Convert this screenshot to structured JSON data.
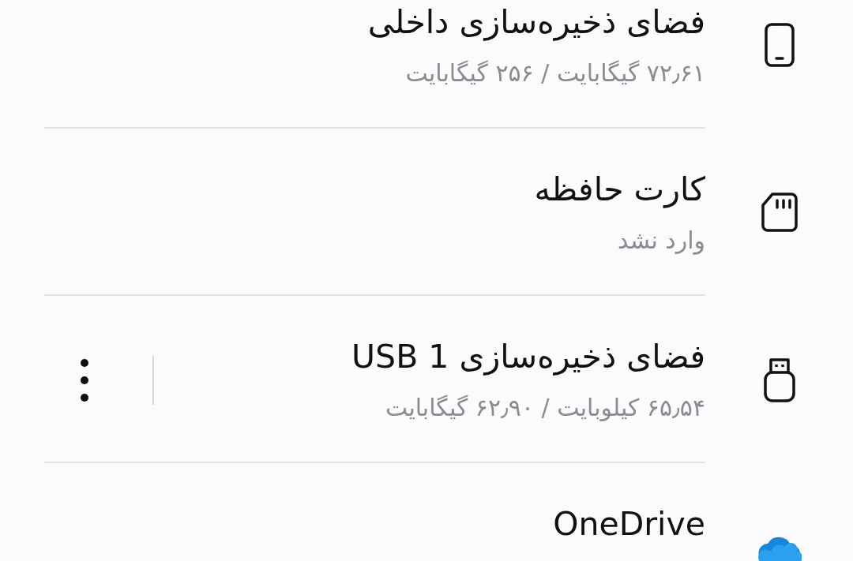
{
  "storage_locations": [
    {
      "kind": "internal",
      "title": "فضای ذخیره‌سازی داخلی",
      "subtitle": "۷۲٫۶۱ گیگابایت / ۲۵۶ گیگابایت",
      "has_menu": false
    },
    {
      "kind": "sdcard",
      "title": "کارت حافظه",
      "subtitle": "وارد نشد",
      "has_menu": false
    },
    {
      "kind": "usb",
      "title": "فضای ذخیره‌سازی USB 1",
      "subtitle": "۶۵٫۵۴ کیلوبایت / ۶۲٫۹۰ گیگابایت",
      "has_menu": true
    },
    {
      "kind": "cloud",
      "title": "OneDrive",
      "has_menu": false
    }
  ]
}
